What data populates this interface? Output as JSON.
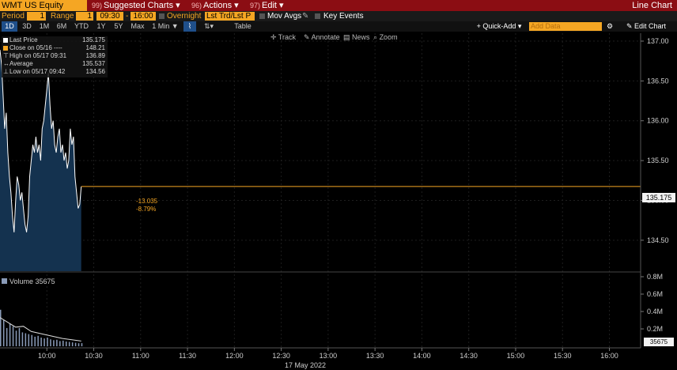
{
  "title_bar": {
    "ticker": "WMT US Equity",
    "menu_suggested": {
      "num": "99)",
      "label": "Suggested Charts"
    },
    "menu_actions": {
      "num": "96)",
      "label": "Actions"
    },
    "menu_edit": {
      "num": "97)",
      "label": "Edit"
    },
    "chart_type": "Line Chart"
  },
  "period_bar": {
    "period_label": "Period",
    "period_value": "1",
    "range_label": "Range",
    "range_value": "1",
    "start_time": "09:30",
    "end_time": "16:00",
    "overnight_label": "Overnight",
    "overnight_value": "Lst Trd/Lst P",
    "mov_avgs": "Mov Avgs",
    "key_events": "Key Events"
  },
  "range_buttons": [
    "1D",
    "3D",
    "1M",
    "6M",
    "YTD",
    "1Y",
    "5Y",
    "Max"
  ],
  "interval": "1 Min",
  "table_label": "Table",
  "quick_add": "Quick-Add",
  "add_data_placeholder": "Add Data",
  "edit_chart": "Edit Chart",
  "tools": {
    "track": "Track",
    "annotate": "Annotate",
    "news": "News",
    "zoom": "Zoom"
  },
  "legend": {
    "last_price": {
      "label": "Last Price",
      "value": "135.175"
    },
    "close": {
      "label": "Close on 05/16 ----",
      "value": "148.21"
    },
    "high": {
      "label": "High on 05/17 09:31",
      "value": "136.89"
    },
    "average": {
      "label": "Average",
      "value": "135.537"
    },
    "low": {
      "label": "Low on 05/17 09:42",
      "value": "134.56"
    }
  },
  "change": {
    "abs": "-13.035",
    "pct": "-8.79%"
  },
  "last_value_box": "135.175",
  "volume_header": "Volume 35675",
  "volume_box": "35675",
  "date_label": "17 May 2022",
  "colors": {
    "title_bg": "#8b0d13",
    "accent": "#f5a623",
    "price_line": "#ffffff",
    "price_fill": "#14324f",
    "last_line": "#f5a623"
  },
  "chart_data": {
    "type": "area",
    "price_axis": {
      "ylim": [
        134.3,
        137.0
      ],
      "ticks": [
        "137.00",
        "136.50",
        "136.00",
        "135.50",
        "135.00",
        "134.50"
      ]
    },
    "volume_axis": {
      "ylim": [
        0,
        800000
      ],
      "ticks": [
        "0.8M",
        "0.6M",
        "0.4M",
        "0.2M"
      ]
    },
    "x_ticks": [
      "10:00",
      "10:30",
      "11:00",
      "11:30",
      "12:00",
      "12:30",
      "13:00",
      "13:30",
      "14:00",
      "14:30",
      "15:00",
      "15:30",
      "16:00"
    ],
    "x_range_minutes": [
      570,
      980
    ],
    "last_price": 135.175,
    "price": [
      [
        570,
        136.89
      ],
      [
        571,
        136.7
      ],
      [
        572,
        136.3
      ],
      [
        573,
        135.9
      ],
      [
        574,
        136.1
      ],
      [
        575,
        135.6
      ],
      [
        576,
        135.3
      ],
      [
        577,
        135.1
      ],
      [
        578,
        134.8
      ],
      [
        579,
        134.6
      ],
      [
        580,
        135.0
      ],
      [
        581,
        135.3
      ],
      [
        582,
        135.2
      ],
      [
        583,
        135.0
      ],
      [
        584,
        135.1
      ],
      [
        585,
        134.9
      ],
      [
        586,
        134.7
      ],
      [
        587,
        134.6
      ],
      [
        588,
        134.8
      ],
      [
        589,
        135.3
      ],
      [
        590,
        135.5
      ],
      [
        591,
        135.7
      ],
      [
        592,
        135.6
      ],
      [
        593,
        135.8
      ],
      [
        594,
        135.6
      ],
      [
        595,
        135.7
      ],
      [
        596,
        135.5
      ],
      [
        597,
        135.9
      ],
      [
        598,
        136.0
      ],
      [
        599,
        136.2
      ],
      [
        600,
        136.4
      ],
      [
        601,
        136.6
      ],
      [
        602,
        136.2
      ],
      [
        603,
        135.9
      ],
      [
        604,
        136.0
      ],
      [
        605,
        135.7
      ],
      [
        606,
        135.6
      ],
      [
        607,
        135.8
      ],
      [
        608,
        135.9
      ],
      [
        609,
        135.6
      ],
      [
        610,
        135.7
      ],
      [
        611,
        135.5
      ],
      [
        612,
        135.6
      ],
      [
        613,
        135.4
      ],
      [
        614,
        135.5
      ],
      [
        615,
        135.9
      ],
      [
        616,
        135.7
      ],
      [
        617,
        135.8
      ],
      [
        618,
        135.3
      ],
      [
        619,
        135.1
      ],
      [
        620,
        134.9
      ],
      [
        621,
        134.95
      ],
      [
        622,
        135.175
      ]
    ],
    "volume": [
      [
        570,
        420000
      ],
      [
        572,
        300000
      ],
      [
        574,
        210000
      ],
      [
        576,
        260000
      ],
      [
        578,
        230000
      ],
      [
        580,
        180000
      ],
      [
        582,
        210000
      ],
      [
        584,
        160000
      ],
      [
        586,
        150000
      ],
      [
        588,
        140000
      ],
      [
        590,
        130000
      ],
      [
        592,
        110000
      ],
      [
        594,
        120000
      ],
      [
        596,
        100000
      ],
      [
        598,
        90000
      ],
      [
        600,
        100000
      ],
      [
        602,
        80000
      ],
      [
        604,
        70000
      ],
      [
        606,
        75000
      ],
      [
        608,
        60000
      ],
      [
        610,
        65000
      ],
      [
        612,
        55000
      ],
      [
        614,
        50000
      ],
      [
        616,
        45000
      ],
      [
        618,
        40000
      ],
      [
        620,
        35000
      ],
      [
        622,
        35675
      ]
    ],
    "volume_avg": [
      [
        570,
        330000
      ],
      [
        580,
        220000
      ],
      [
        585,
        230000
      ],
      [
        590,
        170000
      ],
      [
        600,
        130000
      ],
      [
        610,
        90000
      ],
      [
        622,
        60000
      ]
    ]
  }
}
